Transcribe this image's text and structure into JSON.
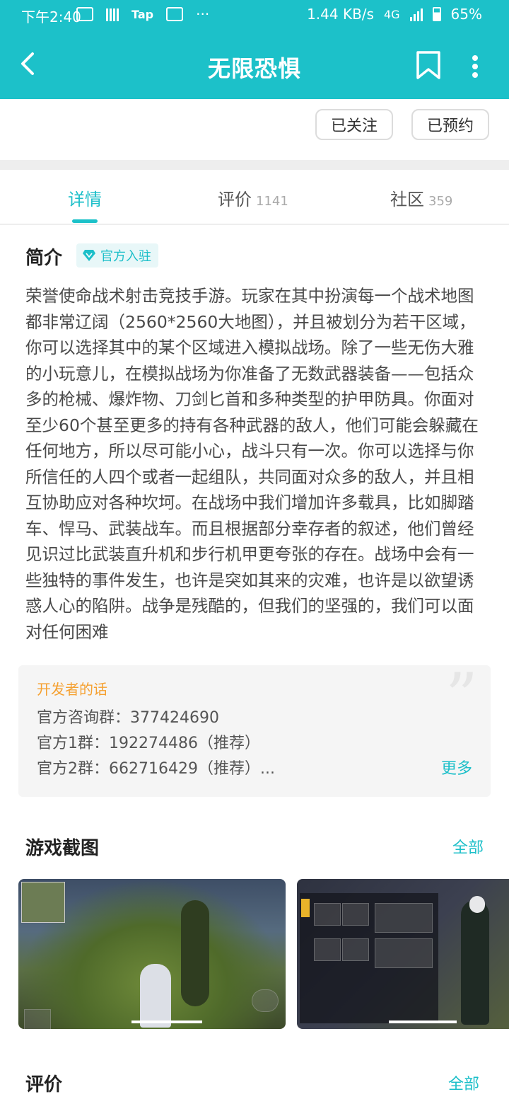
{
  "status_bar": {
    "time": "下午2:40",
    "tap_label": "Tap",
    "net_speed": "1.44 KB/s",
    "network": "4G",
    "battery": "65%"
  },
  "header": {
    "title": "无限恐惧"
  },
  "actions": {
    "follow_label": "已关注",
    "reserve_label": "已预约"
  },
  "tabs": [
    {
      "label": "详情",
      "count": ""
    },
    {
      "label": "评价",
      "count": "1141"
    },
    {
      "label": "社区",
      "count": "359"
    }
  ],
  "intro": {
    "title": "简介",
    "badge": "官方入驻",
    "text": "荣誉使命战术射击竞技手游。玩家在其中扮演每一个战术地图都非常辽阔（2560*2560大地图），并且被划分为若干区域，你可以选择其中的某个区域进入模拟战场。除了一些无伤大雅的小玩意儿，在模拟战场为你准备了无数武器装备——包括众多的枪械、爆炸物、刀剑匕首和多种类型的护甲防具。你面对至少60个甚至更多的持有各种武器的敌人，他们可能会躲藏在任何地方，所以尽可能小心，战斗只有一次。你可以选择与你所信任的人四个或者一起组队，共同面对众多的敌人，并且相互协助应对各种坎坷。在战场中我们增加许多载具，比如脚踏车、悍马、武装战车。而且根据部分幸存者的叙述，他们曾经见识过比武装直升机和步行机甲更夸张的存在。战场中会有一些独特的事件发生，也许是突如其来的灾难，也许是以欲望诱惑人心的陷阱。战争是残酷的，但我们的坚强的，我们可以面对任何困难"
  },
  "dev_note": {
    "label": "开发者的话",
    "lines": [
      "官方咨询群：377424690",
      "官方1群：192274486（推荐）",
      "官方2群：662716429（推荐）..."
    ],
    "more": "更多"
  },
  "screenshots": {
    "title": "游戏截图",
    "all": "全部"
  },
  "reviews": {
    "title": "评价",
    "all": "全部"
  }
}
